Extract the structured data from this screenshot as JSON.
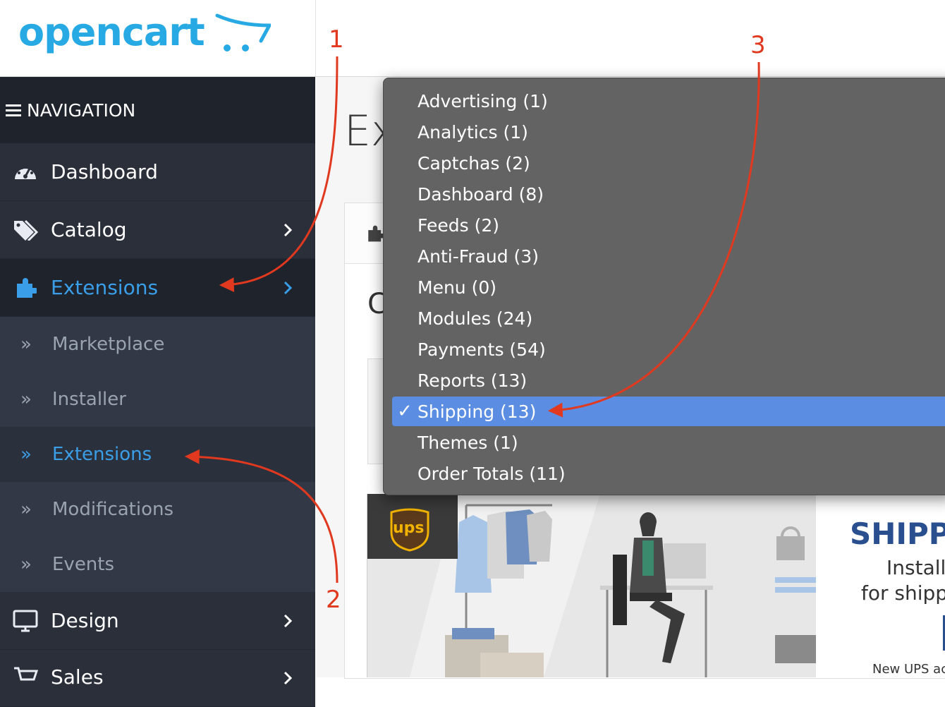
{
  "logo": {
    "text": "opencart"
  },
  "navigation": {
    "title": "NAVIGATION"
  },
  "sidebar": {
    "items": [
      {
        "label": "Dashboard"
      },
      {
        "label": "Catalog"
      },
      {
        "label": "Extensions"
      },
      {
        "label": "Design"
      },
      {
        "label": "Sales"
      }
    ],
    "sub_items": [
      {
        "label": "Marketplace"
      },
      {
        "label": "Installer"
      },
      {
        "label": "Extensions"
      },
      {
        "label": "Modifications"
      },
      {
        "label": "Events"
      }
    ]
  },
  "main": {
    "heading": "Ex",
    "panel_letter": "C"
  },
  "dropdown": {
    "selected_index": 10,
    "check_glyph": "✓",
    "options": [
      "Advertising (1)",
      "Analytics (1)",
      "Captchas (2)",
      "Dashboard (8)",
      "Feeds (2)",
      "Anti-Fraud (3)",
      "Menu (0)",
      "Modules (24)",
      "Payments (54)",
      "Reports (13)",
      "Shipping (13)",
      "Themes (1)",
      "Order Totals (11)"
    ]
  },
  "banner": {
    "ups_text": "ups",
    "title": "SHIPP",
    "line1": "Install",
    "line2": "for shipp",
    "line3": "New UPS ac"
  },
  "annotations": {
    "one": "1",
    "two": "2",
    "three": "3"
  },
  "colors": {
    "accent": "#3a9ee8",
    "annotation": "#e0391f",
    "selection": "#5b8ee2",
    "sidebar": "#2a2f3a"
  }
}
